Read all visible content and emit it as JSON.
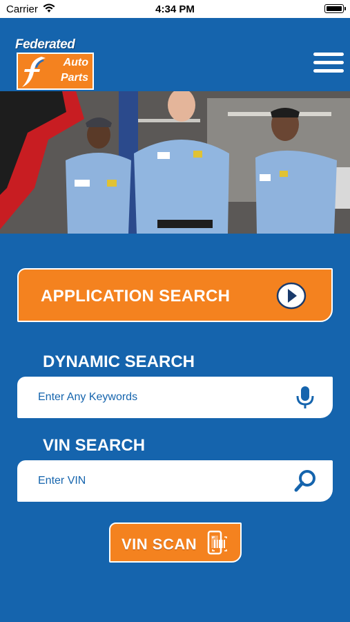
{
  "status_bar": {
    "carrier": "Carrier",
    "time": "4:34 PM"
  },
  "brand": {
    "name": "Federated",
    "line1": "Auto",
    "line2": "Parts"
  },
  "header": {
    "menu_icon": "hamburger-menu-icon"
  },
  "hero": {
    "image": "photo of three smiling auto mechanics in blue uniforms in a garage"
  },
  "application_search": {
    "label": "APPLICATION SEARCH",
    "icon": "play-arrow-circle-icon"
  },
  "dynamic_search": {
    "title": "DYNAMIC SEARCH",
    "placeholder": "Enter Any Keywords",
    "icon": "microphone-icon"
  },
  "vin_search": {
    "title": "VIN SEARCH",
    "placeholder": "Enter VIN",
    "icon": "search-icon"
  },
  "vin_scan": {
    "label": "VIN SCAN",
    "icon": "barcode-scan-icon"
  },
  "colors": {
    "background": "#1564ad",
    "accent": "#f4821f",
    "white": "#ffffff"
  }
}
